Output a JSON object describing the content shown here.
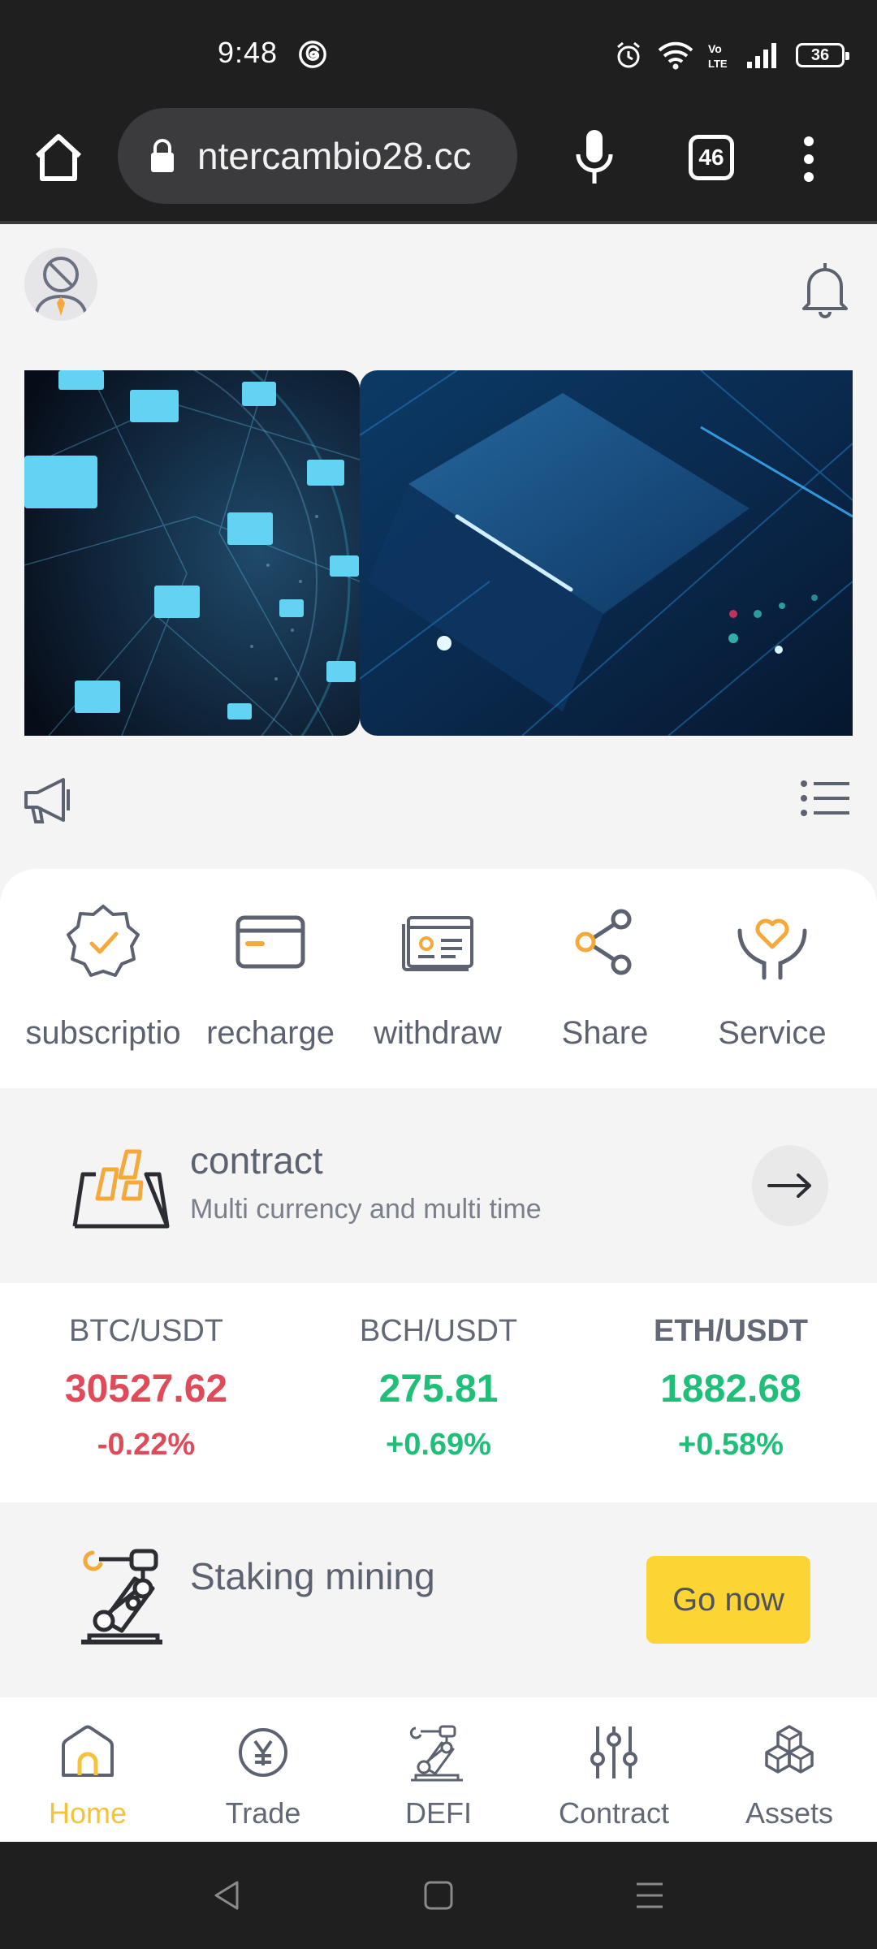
{
  "status_bar": {
    "time": "9:48",
    "battery": "36"
  },
  "browser": {
    "url": "ntercambio28.cc",
    "tab_count": "46"
  },
  "quick_actions": [
    {
      "label": "subscriptio"
    },
    {
      "label": "recharge"
    },
    {
      "label": "withdraw"
    },
    {
      "label": "Share"
    },
    {
      "label": "Service"
    }
  ],
  "contract": {
    "title": "contract",
    "subtitle": "Multi currency and multi time"
  },
  "tickers": [
    {
      "pair": "BTC/USDT",
      "price": "30527.62",
      "change": "-0.22%",
      "trend": "down"
    },
    {
      "pair": "BCH/USDT",
      "price": "275.81",
      "change": "+0.69%",
      "trend": "up"
    },
    {
      "pair": "ETH/USDT",
      "price": "1882.68",
      "change": "+0.58%",
      "trend": "up"
    }
  ],
  "staking": {
    "title": "Staking mining",
    "button": "Go now"
  },
  "bottom_nav": [
    {
      "label": "Home",
      "icon": "home-icon",
      "active": true
    },
    {
      "label": "Trade",
      "icon": "yen-coin-icon",
      "active": false
    },
    {
      "label": "DEFI",
      "icon": "robot-arm-icon",
      "active": false
    },
    {
      "label": "Contract",
      "icon": "sliders-icon",
      "active": false
    },
    {
      "label": "Assets",
      "icon": "cubes-icon",
      "active": false
    }
  ],
  "colors": {
    "accent": "#fcd535",
    "active_nav": "#f5c33b",
    "down": "#e04b5a",
    "up": "#1fbf7a",
    "icon_orange": "#f5a93b"
  }
}
